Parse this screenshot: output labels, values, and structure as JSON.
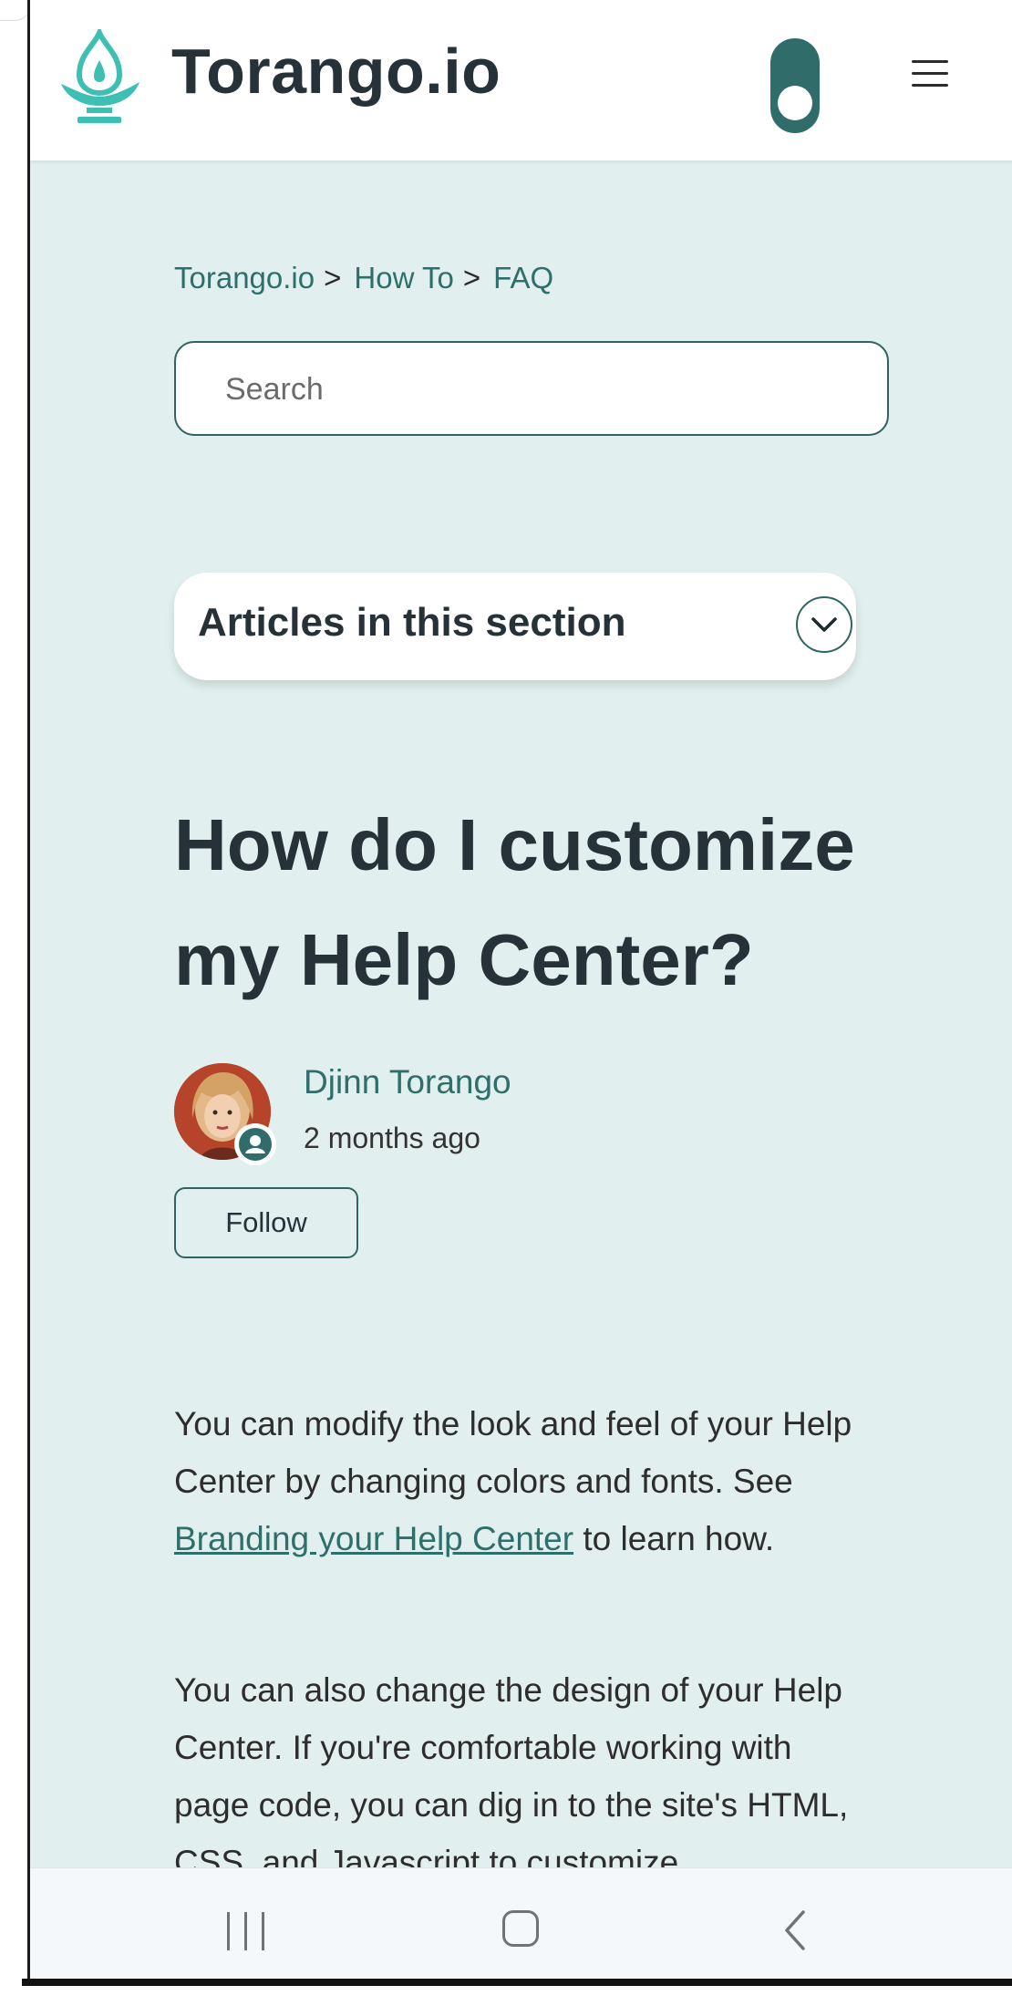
{
  "header": {
    "brand": "Torango.io",
    "logo_icon": "genie-lamp-icon",
    "theme_toggle_icon": "theme-toggle",
    "menu_icon": "hamburger-menu-icon"
  },
  "breadcrumb": [
    {
      "label": "Torango.io"
    },
    {
      "label": "How To"
    },
    {
      "label": "FAQ"
    }
  ],
  "breadcrumb_separator": ">",
  "search": {
    "placeholder": "Search",
    "value": ""
  },
  "articles_section": {
    "label": "Articles in this section",
    "icon": "chevron-down-icon"
  },
  "article": {
    "title": "How do I customize my Help Center?",
    "author": {
      "name": "Djinn Torango",
      "time": "2 months ago",
      "badge_icon": "user-icon"
    },
    "follow_label": "Follow",
    "para1_before": "You can modify the look and feel of your Help Center by changing colors and fonts. See ",
    "para1_link": "Branding your Help Center",
    "para1_after": " to learn how.",
    "para2": "You can also change the design of your Help Center. If you're comfortable working with page code, you can dig in to the site's HTML, CSS, and Javascript to customize"
  },
  "navbar": {
    "recents_icon": "recents-icon",
    "home_icon": "home-icon",
    "back_icon": "back-icon"
  },
  "colors": {
    "accent": "#2f6c6a",
    "background": "#e1f0ee",
    "logo": "#3ebfb4",
    "text": "#263238"
  }
}
